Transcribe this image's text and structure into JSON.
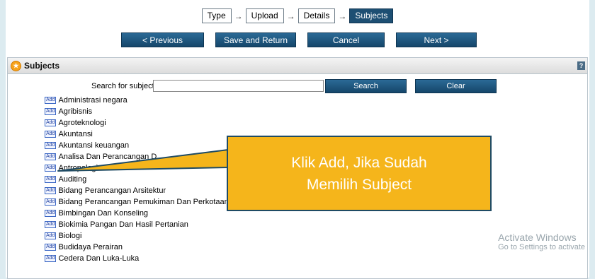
{
  "stepper": {
    "steps": [
      "Type",
      "Upload",
      "Details",
      "Subjects"
    ],
    "arrow": "→"
  },
  "nav": {
    "previous": "< Previous",
    "save_return": "Save and Return",
    "cancel": "Cancel",
    "next": "Next >"
  },
  "panel": {
    "title": "Subjects",
    "help": "?"
  },
  "search": {
    "label": "Search for subject:",
    "value": "",
    "search_button": "Search",
    "clear_button": "Clear"
  },
  "add_label": "Add",
  "subjects": [
    "Administrasi negara",
    "Agribisnis",
    "Agroteknologi",
    "Akuntansi",
    "Akuntansi keuangan",
    "Analisa Dan Perancangan D",
    "Antropologi",
    "Auditing",
    "Bidang Perancangan Arsitektur",
    "Bidang Perancangan Pemukiman Dan Perkotaan",
    "Bimbingan Dan Konseling",
    "Biokimia Pangan Dan Hasil Pertanian",
    "Biologi",
    "Budidaya Perairan",
    "Cedera Dan Luka-Luka"
  ],
  "callout": {
    "text_line1": "Klik Add, Jika Sudah",
    "text_line2": "Memilih Subject"
  },
  "watermark": {
    "line1": "Activate Windows",
    "line2": "Go to Settings to activate"
  }
}
